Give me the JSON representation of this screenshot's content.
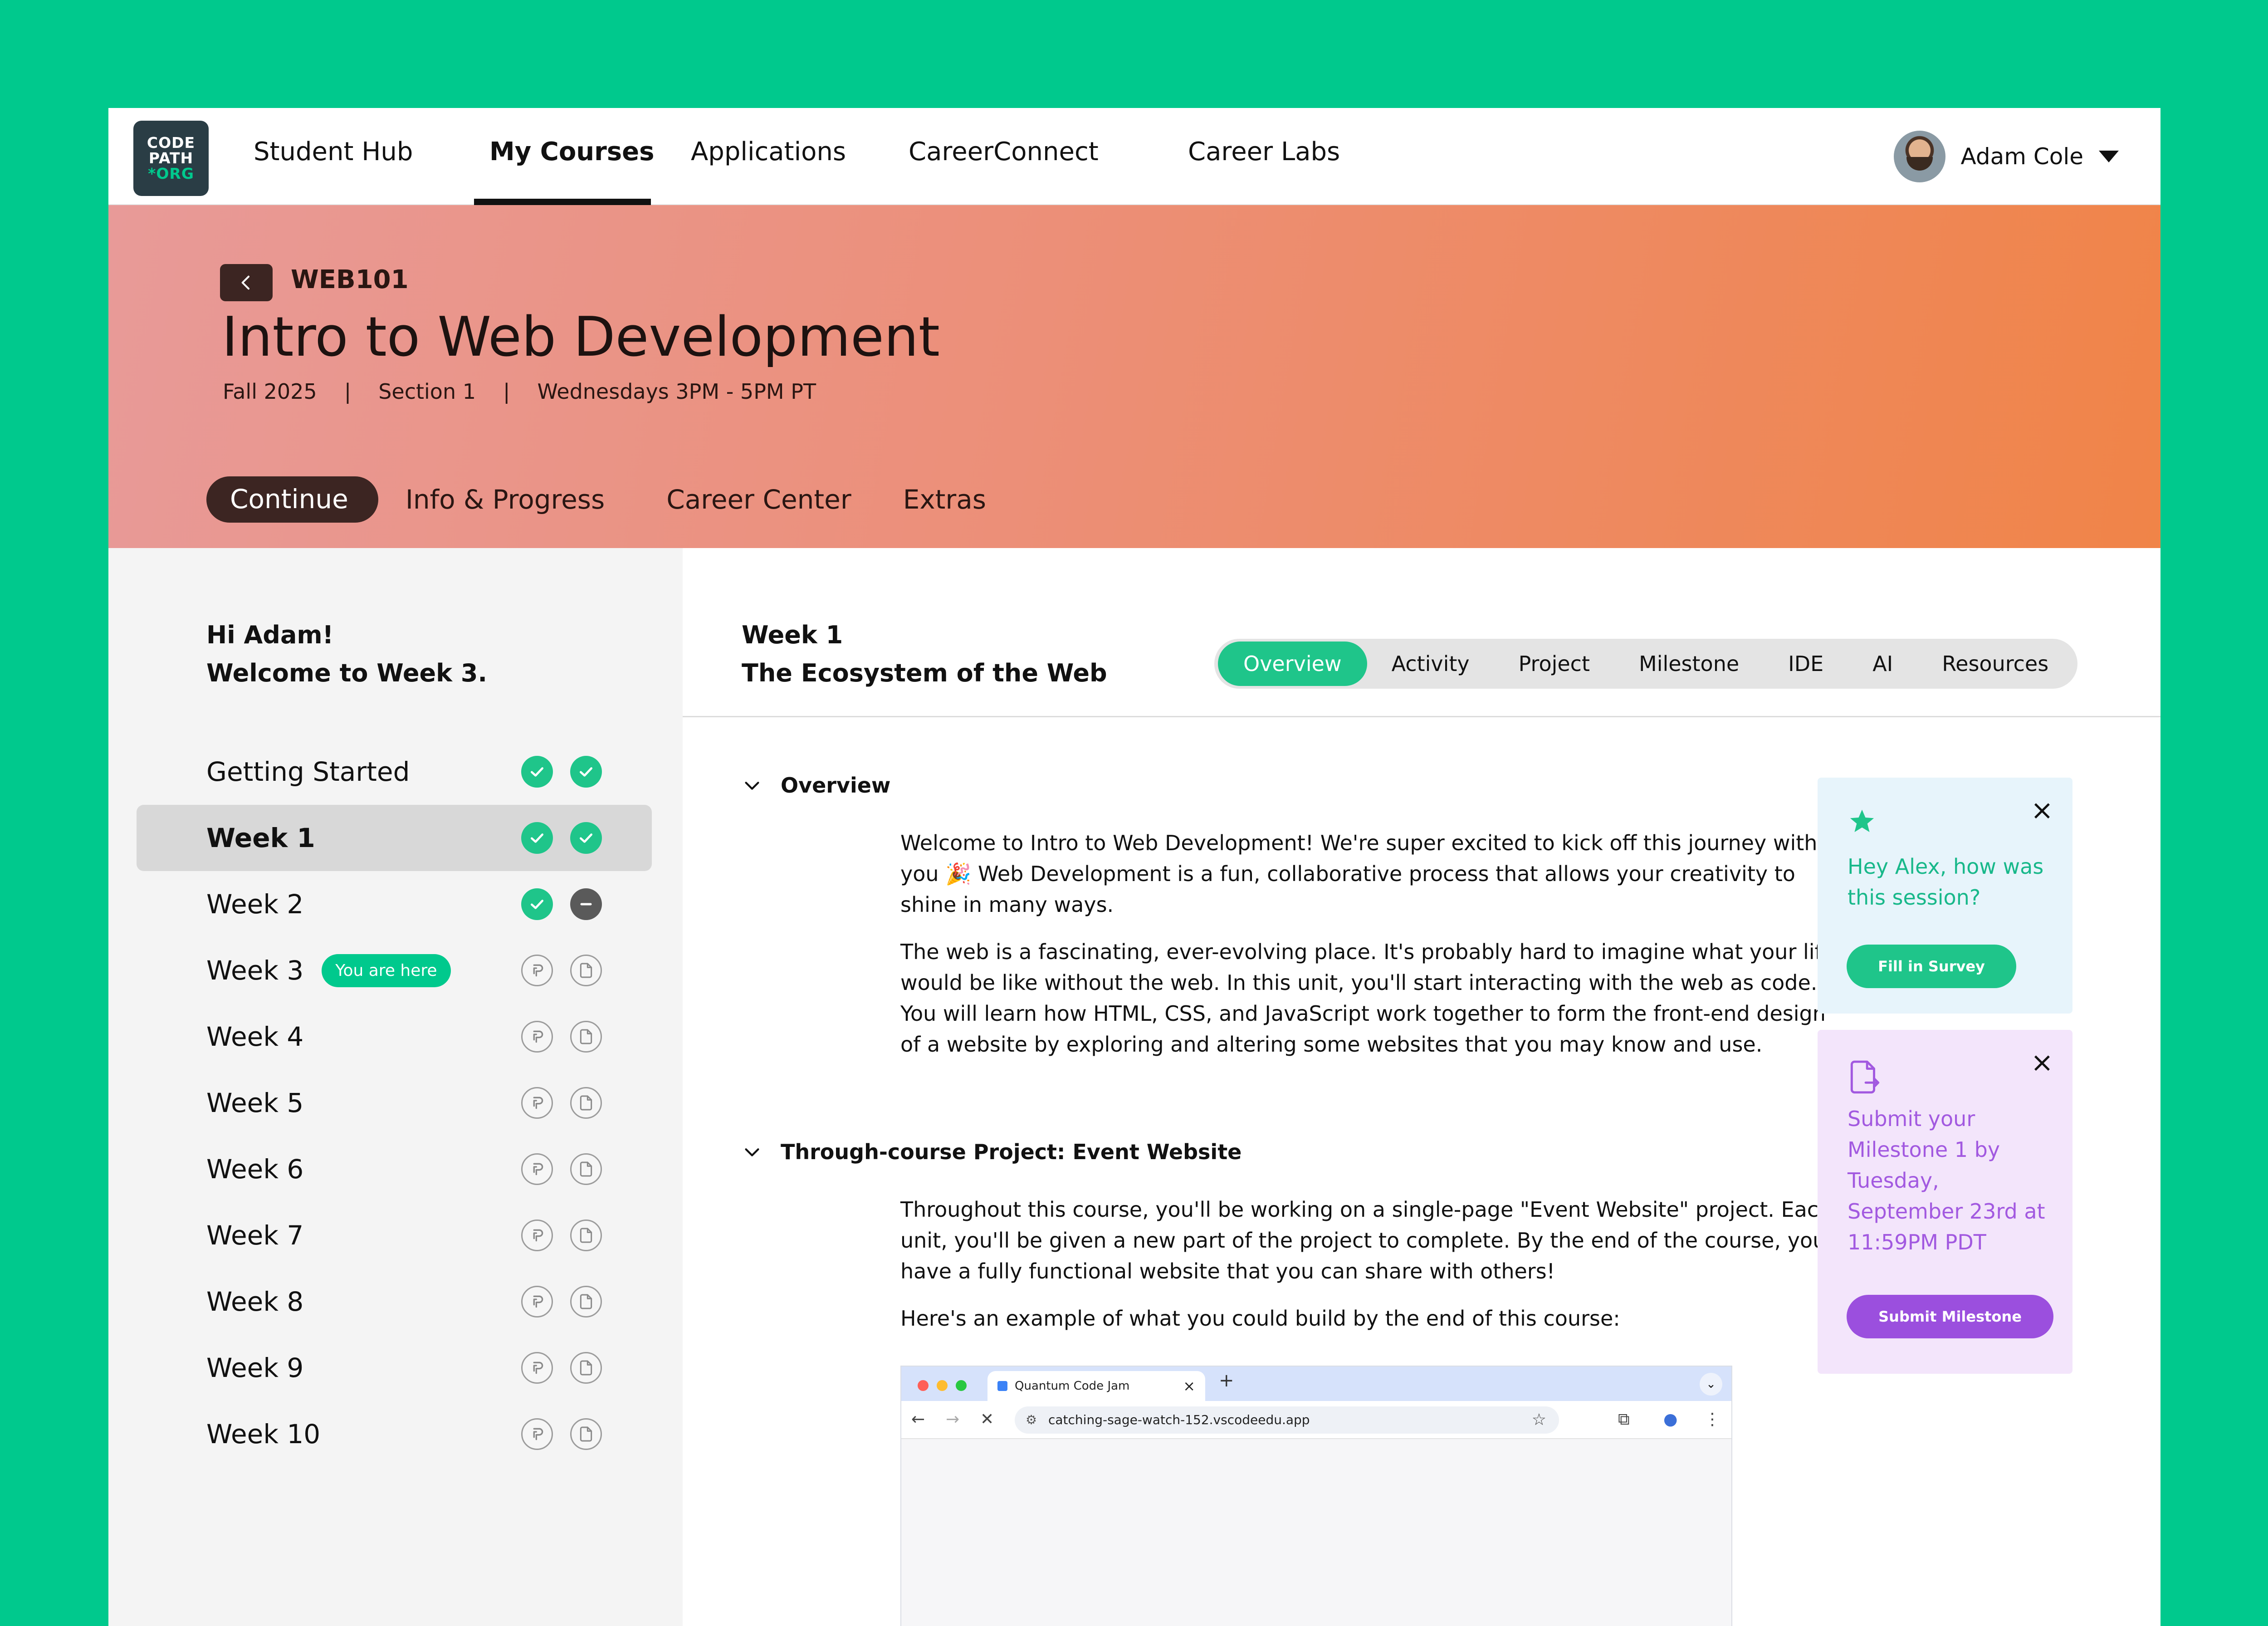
{
  "logo": {
    "line1": "CODE",
    "line2": "PATH",
    "line3": "*ORG"
  },
  "nav": {
    "items": [
      "Student Hub",
      "My Courses",
      "Applications",
      "CareerConnect",
      "Career Labs"
    ],
    "active": "My Courses"
  },
  "user": {
    "name": "Adam Cole"
  },
  "course": {
    "code": "WEB101",
    "title": "Intro to Web Development",
    "term": "Fall 2025",
    "sep": "|",
    "section": "Section 1",
    "schedule": "Wednesdays 3PM - 5PM PT"
  },
  "hero_tabs": [
    "Continue",
    "Info & Progress",
    "Career Center",
    "Extras"
  ],
  "sidebar": {
    "greeting_line1": "Hi Adam!",
    "greeting_line2": "Welcome to Week 3.",
    "here_badge": "You are here",
    "weeks": [
      {
        "label": "Getting Started",
        "status": [
          "complete",
          "complete"
        ]
      },
      {
        "label": "Week 1",
        "status": [
          "complete",
          "complete"
        ],
        "selected": true
      },
      {
        "label": "Week 2",
        "status": [
          "complete",
          "incomplete"
        ]
      },
      {
        "label": "Week 3",
        "status": [
          "pending",
          "pending"
        ],
        "current": true
      },
      {
        "label": "Week 4",
        "status": [
          "pending",
          "pending"
        ]
      },
      {
        "label": "Week 5",
        "status": [
          "pending",
          "pending"
        ]
      },
      {
        "label": "Week 6",
        "status": [
          "pending",
          "pending"
        ]
      },
      {
        "label": "Week 7",
        "status": [
          "pending",
          "pending"
        ]
      },
      {
        "label": "Week 8",
        "status": [
          "pending",
          "pending"
        ]
      },
      {
        "label": "Week 9",
        "status": [
          "pending",
          "pending"
        ]
      },
      {
        "label": "Week 10",
        "status": [
          "pending",
          "pending"
        ]
      }
    ]
  },
  "main": {
    "week_label": "Week 1",
    "week_title": "The Ecosystem of the Web",
    "tabs": [
      "Overview",
      "Activity",
      "Project",
      "Milestone",
      "IDE",
      "AI",
      "Resources"
    ],
    "active_tab": "Overview",
    "overview": {
      "heading": "Overview",
      "p1": "Welcome to Intro to Web Development! We're super excited to kick off this journey with you 🎉 Web Development is a fun, collaborative process that allows your creativity to shine in many ways.",
      "p2": "The web is a fascinating, ever-evolving place. It's probably hard to imagine what your life would be like without the web. In this unit, you'll start interacting with the web as code. You will learn how HTML, CSS, and JavaScript work together to form the front-end design of a website by exploring and altering some websites that you may know and use."
    },
    "project": {
      "heading": "Through-course Project: Event Website",
      "p1": "Throughout this course, you'll be working on a single-page \"Event Website\" project. Each unit, you'll be given a new part of the project to complete. By the end of the course, you'll have a fully functional website that you can share with others!",
      "p2": "Here's an example of what you could build by the end of this course:"
    },
    "browser": {
      "tab_title": "Quantum Code Jam",
      "url": "catching-sage-watch-152.vscodeedu.app"
    }
  },
  "cards": {
    "survey": {
      "text": "Hey Alex, how was this session?",
      "button": "Fill in Survey"
    },
    "milestone": {
      "text": "Submit your Milestone 1 by Tuesday, September 23rd at 11:59PM PDT",
      "button": "Submit Milestone"
    }
  },
  "colors": {
    "background": "#00c98d",
    "accent_green": "#1fc58a",
    "hero_start": "#e89a98",
    "hero_end": "#f08448",
    "milestone_purple": "#9b4fde"
  }
}
